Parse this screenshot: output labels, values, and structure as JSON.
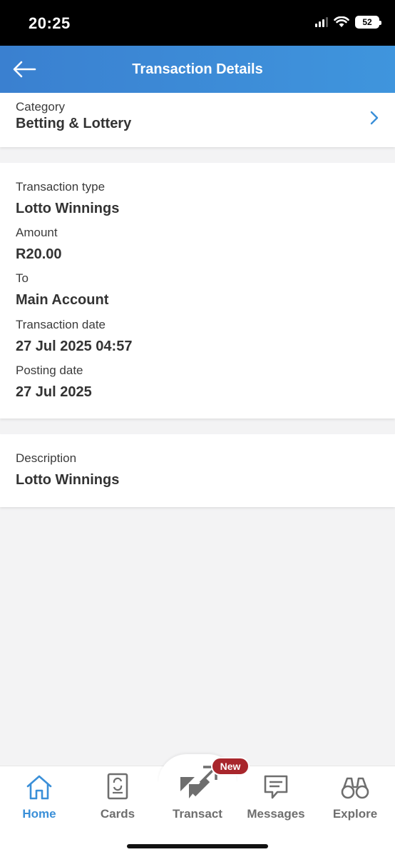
{
  "status_bar": {
    "time": "20:25",
    "battery": "52"
  },
  "header": {
    "title": "Transaction Details"
  },
  "category": {
    "label": "Category",
    "value": "Betting & Lottery"
  },
  "details": {
    "transaction_type_label": "Transaction type",
    "transaction_type_value": "Lotto Winnings",
    "amount_label": "Amount",
    "amount_value": "R20.00",
    "to_label": "To",
    "to_value": "Main Account",
    "transaction_date_label": "Transaction date",
    "transaction_date_value": "27 Jul 2025 04:57",
    "posting_date_label": "Posting date",
    "posting_date_value": "27 Jul 2025"
  },
  "description": {
    "label": "Description",
    "value": "Lotto Winnings"
  },
  "tab_bar": {
    "tabs": [
      {
        "label": "Home",
        "icon": "home-icon",
        "active": true
      },
      {
        "label": "Cards",
        "icon": "card-icon",
        "active": false
      },
      {
        "label": "Transact",
        "icon": "transact-arrows-icon",
        "active": false
      },
      {
        "label": "Messages",
        "icon": "message-icon",
        "active": false
      },
      {
        "label": "Explore",
        "icon": "binoculars-icon",
        "active": false
      }
    ],
    "badge": "New"
  },
  "colors": {
    "header": "#3a86d4",
    "accent": "#3a8fd8",
    "badge": "#a8262c",
    "background": "#f3f3f4"
  }
}
